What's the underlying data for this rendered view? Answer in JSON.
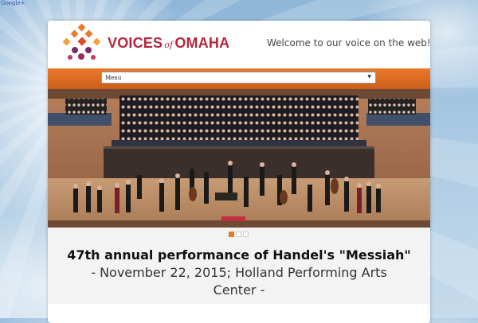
{
  "page": {
    "google_plus_link": "Google+"
  },
  "header": {
    "brand_main": "VOICES",
    "brand_of": "of",
    "brand_city": "OMAHA",
    "welcome": "Welcome to our voice on the web!"
  },
  "nav": {
    "menu_label": "Menu",
    "accent_color": "#e8792b"
  },
  "slider": {
    "dots": [
      true,
      false,
      false
    ]
  },
  "caption": {
    "title": "47th annual performance of Handel's \"Messiah\"",
    "subtitle": "- November 22, 2015; Holland Performing Arts Center -"
  },
  "colors": {
    "brand": "#b3273f",
    "accent": "#e8792b"
  }
}
